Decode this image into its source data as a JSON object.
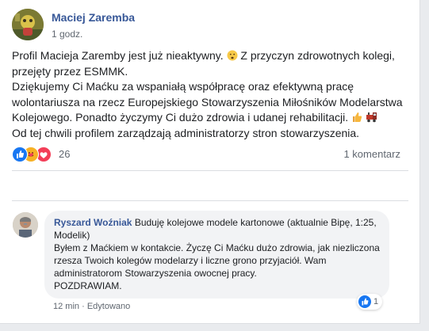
{
  "post": {
    "author": "Maciej Zaremba",
    "time": "1 godz.",
    "paragraphs": [
      "Profil Macieja Zaremby jest już nieaktywny.",
      "Z przyczyn zdrowotnych kolegi, przejęty przez ESMMK.",
      "Dziękujemy Ci Maćku za wspaniałą współpracę oraz efektywną pracę wolontariusza na rzecz Europejskiego Stowarzyszenia Miłośników Modelarstwa Kolejowego. Ponadto życzymy Ci dużo zdrowia i udanej rehabilitacji.",
      "Od tej chwili profilem zarządzają administratorzy stron stowarzyszenia."
    ],
    "emoji_sad": "sad-face-emoji",
    "emoji_thumb": "thumbs-up-emoji",
    "emoji_train": "locomotive-emoji"
  },
  "reactions": {
    "count": "26",
    "types": [
      "like",
      "care",
      "love"
    ],
    "comments_label": "1 komentarz"
  },
  "comment": {
    "author": "Ryszard Woźniak",
    "headline": "Buduję kolejowe modele kartonowe (aktualnie Bipę, 1:25, Modelik)",
    "body": "Byłem z Maćkiem w kontakcie. Życzę Ci Maćku dużo zdrowia, jak niezliczona rzesza Twoich kolegów modelarzy i liczne grono przyjaciół. Wam administratorom Stowarzyszenia owocnej pracy.",
    "closing": "POZDRAWIAM.",
    "time": "12 min",
    "separator": "·",
    "edited": "Edytowano",
    "like_count": "1"
  },
  "colors": {
    "link": "#385898",
    "like_blue": "#1877f2",
    "love_red": "#f33e58",
    "care_yellow": "#f7b125"
  }
}
